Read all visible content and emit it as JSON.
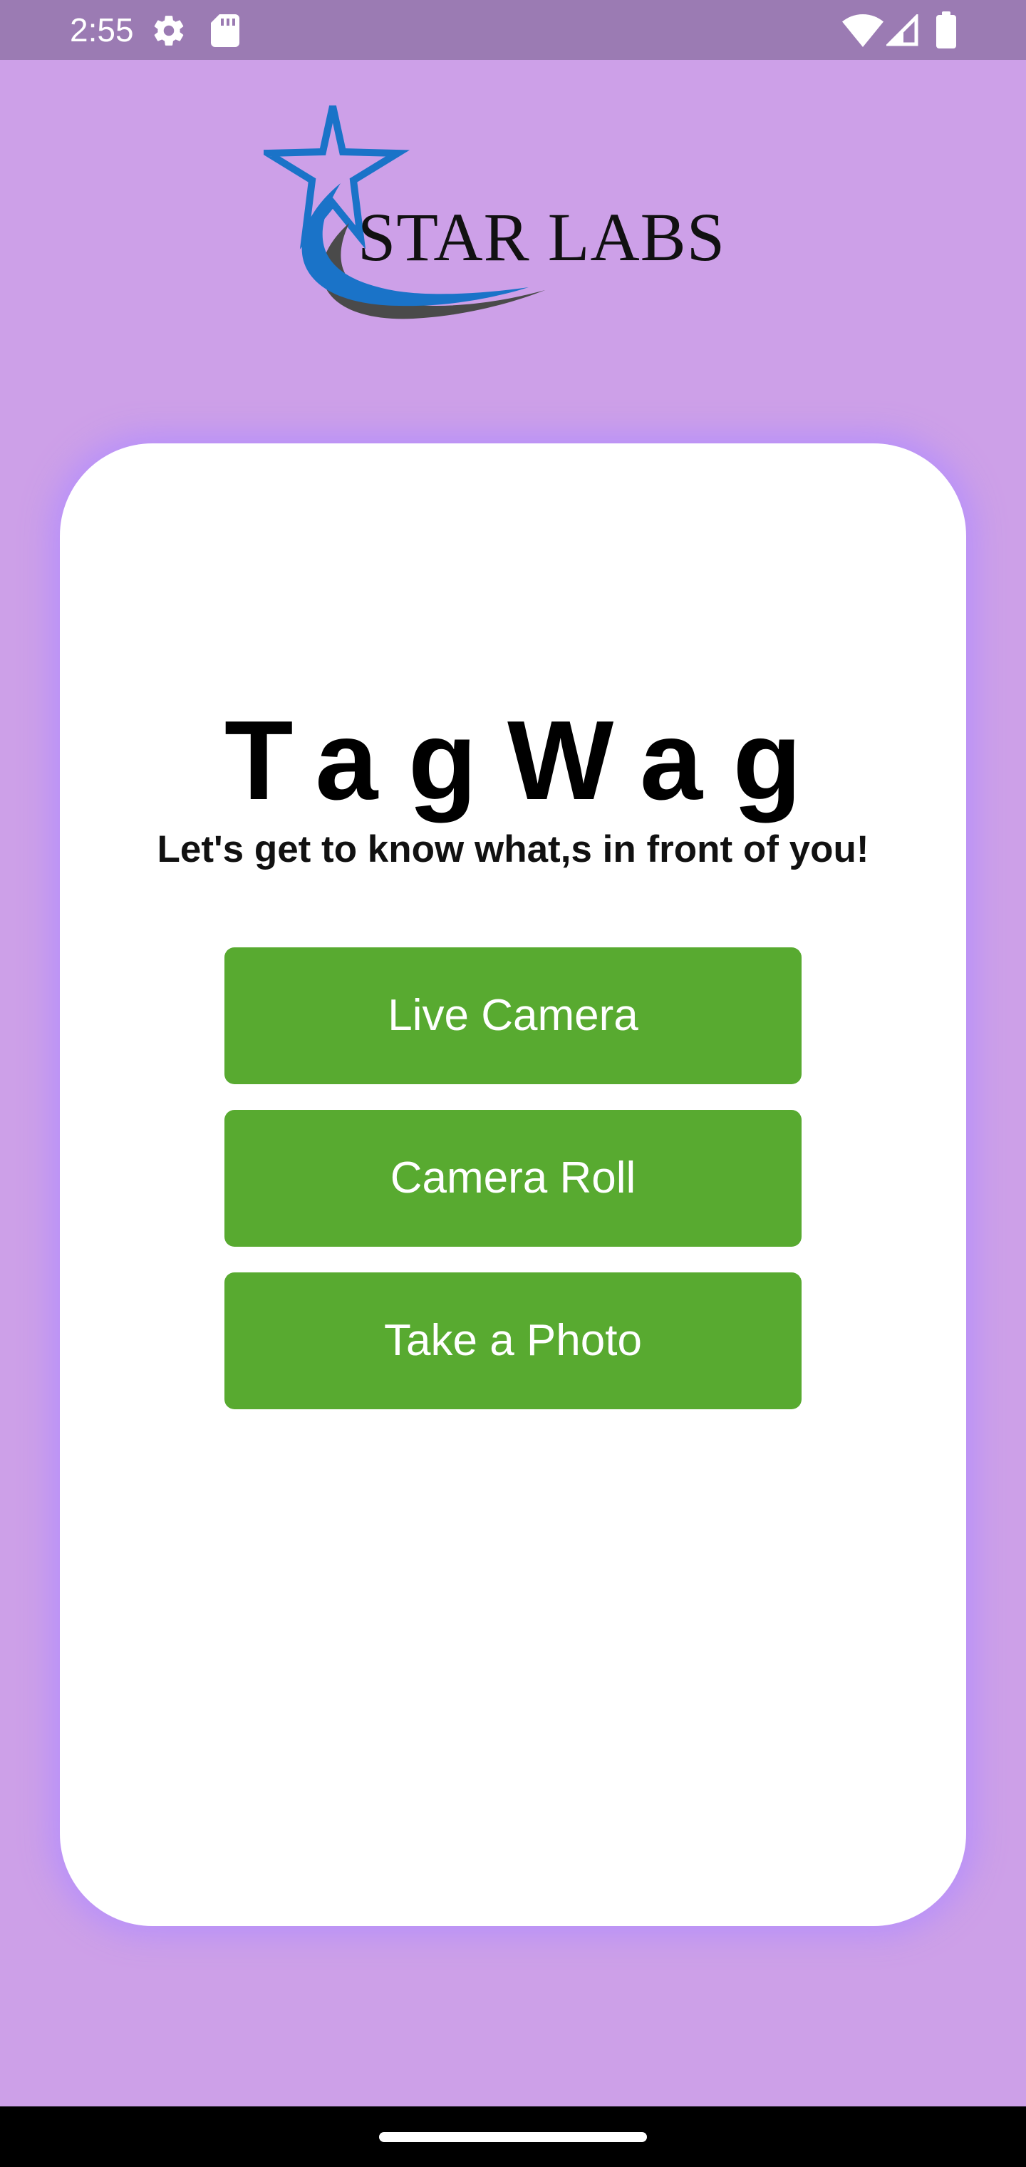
{
  "status_bar": {
    "time": "2:55",
    "icons": [
      "settings-icon",
      "sd-card-icon",
      "wifi-icon",
      "signal-icon",
      "battery-icon"
    ],
    "background_color": "#9B7BB3"
  },
  "logo": {
    "text": "STAR LABS",
    "star_color": "#1A73C8",
    "swoosh_color": "#4A4A4A"
  },
  "card": {
    "title": "TagWag",
    "subtitle": "Let's get to know what,s in front of you!"
  },
  "buttons": {
    "live_camera": "Live Camera",
    "camera_roll": "Camera Roll",
    "take_photo": "Take a Photo"
  },
  "colors": {
    "background": "#CDA0E8",
    "button": "#58AA30",
    "card_glow": "#B28CFF"
  }
}
